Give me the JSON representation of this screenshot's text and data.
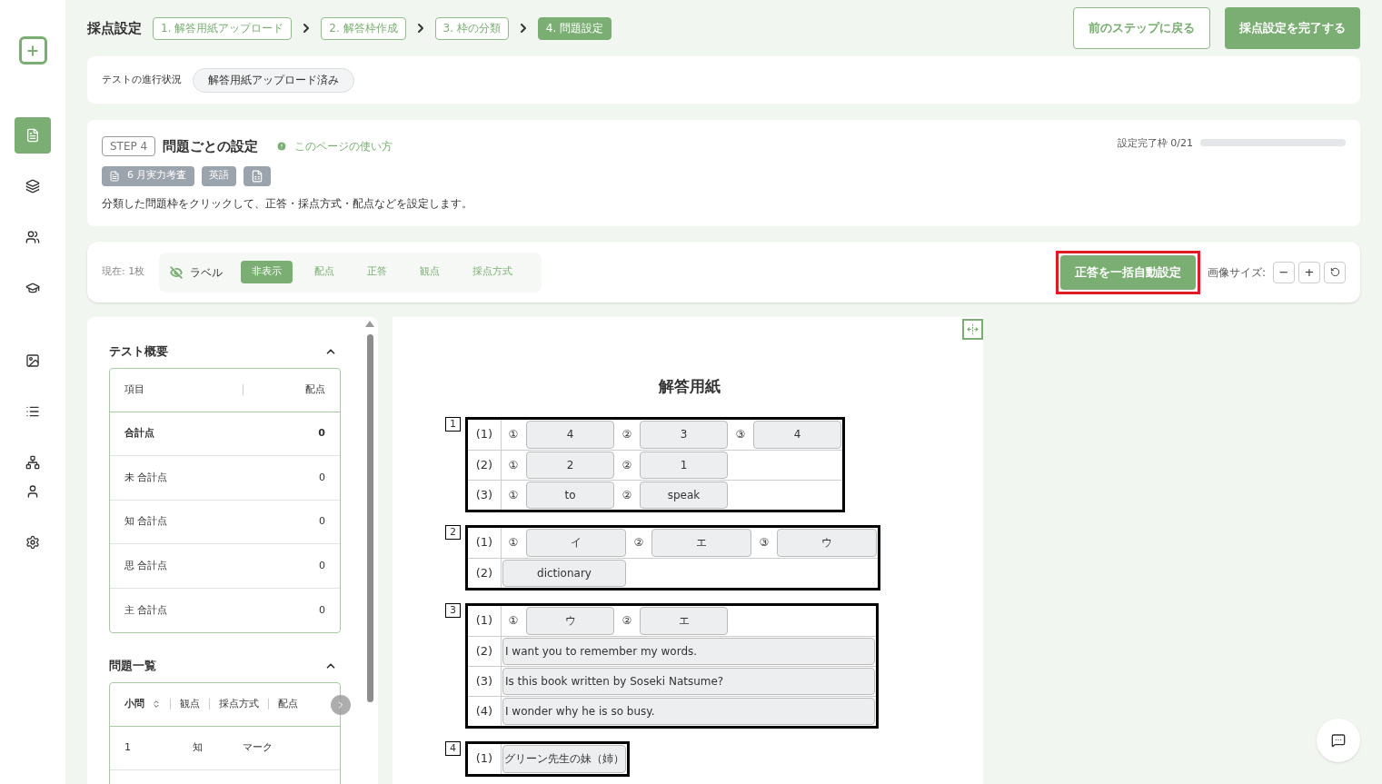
{
  "page_title": "採点設定",
  "steps": [
    {
      "label": "1. 解答用紙アップロード",
      "selected": false
    },
    {
      "label": "2. 解答枠作成",
      "selected": false
    },
    {
      "label": "3. 枠の分類",
      "selected": false
    },
    {
      "label": "4. 問題設定",
      "selected": true
    }
  ],
  "header_buttons": {
    "back": "前のステップに戻る",
    "finish": "採点設定を完了する"
  },
  "status": {
    "label": "テストの進行状況",
    "badge": "解答用紙アップロード済み"
  },
  "step_card": {
    "step": "STEP 4",
    "title": "問題ごとの設定",
    "help": "このページの使い方",
    "tags": [
      "6 月実力考査",
      "英語"
    ],
    "description": "分類した問題枠をクリックして、正答・採点方式・配点などを設定します。",
    "progress_label": "設定完了枠 0/21",
    "level": 0
  },
  "toolbar": {
    "current": "現在: 1枚",
    "label_title": "ラベル",
    "options": [
      {
        "label": "非表示",
        "selected": true
      },
      {
        "label": "配点",
        "selected": false
      },
      {
        "label": "正答",
        "selected": false
      },
      {
        "label": "観点",
        "selected": false
      },
      {
        "label": "採点方式",
        "selected": false
      }
    ],
    "auto_button": "正答を一括自動設定",
    "size_label": "画像サイズ:",
    "zoom_out": "−",
    "zoom_in": "+"
  },
  "summary": {
    "title": "テスト概要",
    "columns": [
      "項目",
      "配点"
    ],
    "rows": [
      {
        "item": "合計点",
        "points": "0",
        "total": true
      },
      {
        "item": "未 合計点",
        "points": "0",
        "total": false
      },
      {
        "item": "知 合計点",
        "points": "0",
        "total": false
      },
      {
        "item": "思 合計点",
        "points": "0",
        "total": false
      },
      {
        "item": "主 合計点",
        "points": "0",
        "total": false
      }
    ]
  },
  "questions": {
    "title": "問題一覧",
    "columns": [
      "小問",
      "観点",
      "採点方式",
      "配点"
    ],
    "rows": [
      {
        "cells": [
          "1",
          "知",
          "マーク"
        ]
      }
    ]
  },
  "sheet": {
    "title": "解答用紙",
    "sections": [
      {
        "number": "1",
        "rows": [
          {
            "label": "(1)",
            "parts": [
              {
                "mark": "①",
                "answer": "4",
                "kind": "s"
              },
              {
                "mark": "②",
                "answer": "3",
                "kind": "s"
              },
              {
                "mark": "③",
                "answer": "4",
                "kind": "s"
              }
            ]
          },
          {
            "label": "(2)",
            "parts": [
              {
                "mark": "①",
                "answer": "2",
                "kind": "s"
              },
              {
                "mark": "②",
                "answer": "1",
                "kind": "s"
              }
            ]
          },
          {
            "label": "(3)",
            "parts": [
              {
                "mark": "①",
                "answer": "to",
                "kind": "s"
              },
              {
                "mark": "②",
                "answer": "speak",
                "kind": "s"
              }
            ]
          }
        ]
      },
      {
        "number": "2",
        "rows": [
          {
            "label": "(1)",
            "parts": [
              {
                "mark": "①",
                "answer": "イ",
                "kind": "m"
              },
              {
                "mark": "②",
                "answer": "エ",
                "kind": "m"
              },
              {
                "mark": "③",
                "answer": "ウ",
                "kind": "m"
              }
            ]
          },
          {
            "label": "(2)",
            "parts": [
              {
                "answer": "dictionary",
                "kind": "m"
              }
            ]
          }
        ]
      },
      {
        "number": "3",
        "rows": [
          {
            "label": "(1)",
            "parts": [
              {
                "mark": "①",
                "answer": "ウ",
                "kind": "s"
              },
              {
                "mark": "②",
                "answer": "エ",
                "kind": "s"
              }
            ]
          },
          {
            "label": "(2)",
            "parts": [
              {
                "answer": "I want you to remember my words.",
                "kind": "l"
              }
            ]
          },
          {
            "label": "(3)",
            "parts": [
              {
                "answer": "Is this book written by Soseki Natsume?",
                "kind": "l"
              }
            ]
          },
          {
            "label": "(4)",
            "parts": [
              {
                "answer": "I wonder why he is so busy.",
                "kind": "l"
              }
            ]
          }
        ]
      },
      {
        "number": "4",
        "rows": [
          {
            "label": "(1)",
            "parts": [
              {
                "answer": "グリーン先生の妹（姉）",
                "kind": "m"
              }
            ]
          }
        ]
      }
    ]
  }
}
